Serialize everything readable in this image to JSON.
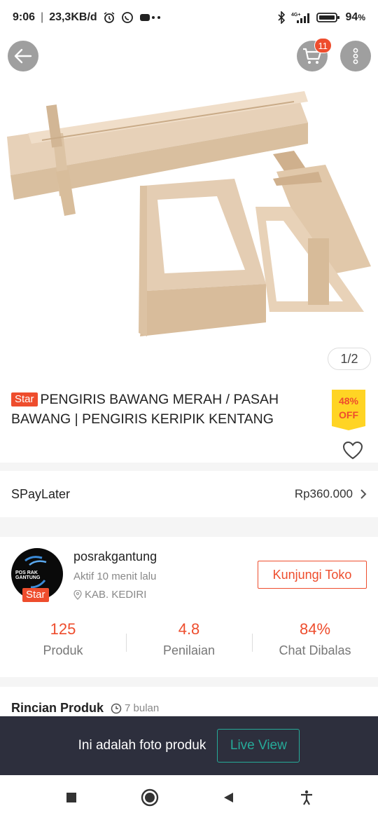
{
  "status_bar": {
    "time": "9:06",
    "speed": "23,3KB/d",
    "battery": "94",
    "network": "4G+"
  },
  "header": {
    "cart_count": "11"
  },
  "gallery": {
    "pager": "1/2"
  },
  "product": {
    "badge": "Star",
    "title": "PENGIRIS BAWANG MERAH / PASAH BAWANG | PENGIRIS KERIPIK KENTANG",
    "discount_pct": "48%",
    "discount_word": "OFF"
  },
  "spaylater": {
    "label": "SPayLater",
    "price": "Rp360.000"
  },
  "shop": {
    "name": "posrakgantung",
    "active": "Aktif 10 menit lalu",
    "location": "KAB. KEDIRI",
    "badge": "Star",
    "avatar_text": "POS RAK GANTUNG",
    "visit_label": "Kunjungi Toko",
    "stats": [
      {
        "value": "125",
        "label": "Produk"
      },
      {
        "value": "4.8",
        "label": "Penilaian"
      },
      {
        "value": "84%",
        "label": "Chat Dibalas"
      }
    ]
  },
  "details": {
    "title": "Rincian Produk",
    "time": "7 bulan"
  },
  "photo_banner": {
    "text": "Ini adalah foto produk",
    "button": "Live View"
  },
  "colors": {
    "accent": "#ee4d2d",
    "teal": "#26aa99",
    "banner_bg": "#2d2f3d",
    "discount_bg": "#ffd424"
  }
}
